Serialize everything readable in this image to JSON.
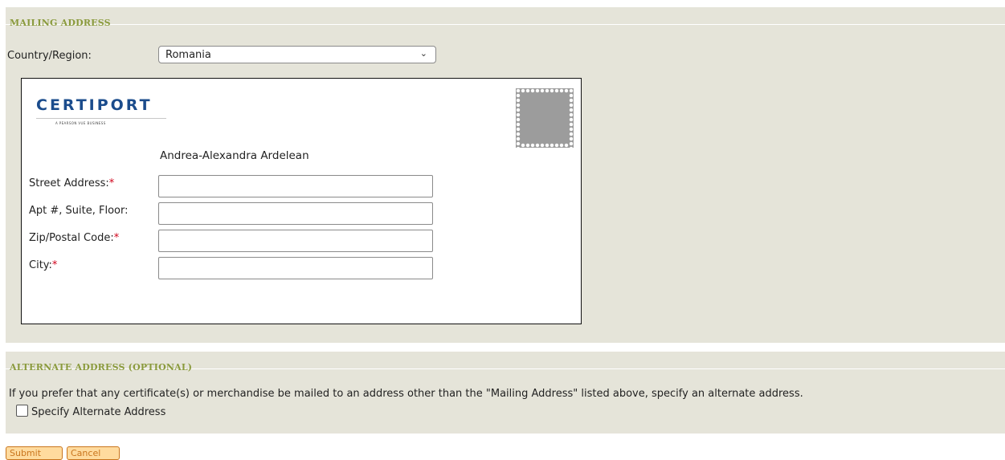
{
  "mailing": {
    "section_title": "MAILING ADDRESS",
    "country_label": "Country/Region:",
    "country_value": "Romania",
    "chevron_glyph": "⌄",
    "logo_text": "CERTIPORT",
    "logo_sub": "A PEARSON VUE BUSINESS",
    "recipient_name": "Andrea-Alexandra Ardelean",
    "fields": [
      {
        "label": "Street Address:",
        "required": "*"
      },
      {
        "label": "Apt #, Suite, Floor:",
        "required": ""
      },
      {
        "label": "Zip/Postal Code:",
        "required": "*"
      },
      {
        "label": "City:",
        "required": "*"
      }
    ]
  },
  "alternate": {
    "section_title": "ALTERNATE ADDRESS (OPTIONAL)",
    "description": "If you prefer that any certificate(s) or merchandise be mailed to an address other than the \"Mailing Address\" listed above, specify an alternate address.",
    "checkbox_label": "Specify Alternate Address",
    "checkbox_checked": false
  },
  "actions": {
    "submit_label": "Submit",
    "cancel_label": "Cancel"
  },
  "colors": {
    "panel_bg": "#e5e4d9",
    "section_title": "#8a9a3c",
    "required_mark": "#d0021b",
    "button_bg": "#ffdb9e",
    "button_text": "#c9751d",
    "logo_blue": "#1b4c8c"
  }
}
